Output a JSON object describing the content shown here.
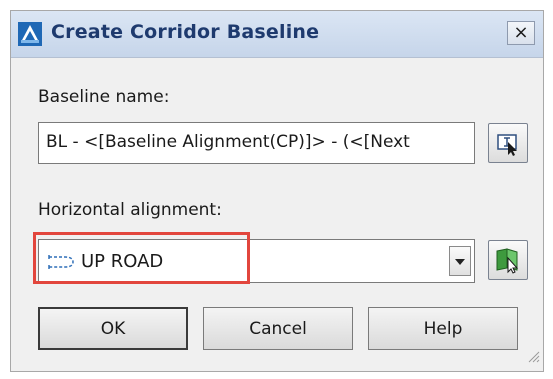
{
  "window": {
    "title": "Create Corridor Baseline",
    "close_glyph": "×"
  },
  "baseline_name": {
    "label": "Baseline name:",
    "value": "BL - <[Baseline Alignment(CP)]> - (<[Next"
  },
  "horizontal_alignment": {
    "label": "Horizontal alignment:",
    "selected": "UP ROAD"
  },
  "buttons": {
    "ok": "OK",
    "cancel": "Cancel",
    "help": "Help"
  },
  "colors": {
    "highlight": "#e2463d",
    "title_text": "#1e3a6e",
    "titlebar": "#c6d5ea",
    "dialog_bg": "#f0f0f0"
  },
  "icons": {
    "app": "civil3d-app-icon",
    "name_editor": "name-template-icon",
    "alignment_type": "alignment-icon",
    "pick_from_drawing": "pick-from-drawing-icon",
    "dropdown": "chevron-down-icon",
    "resize": "resize-grip-icon"
  }
}
